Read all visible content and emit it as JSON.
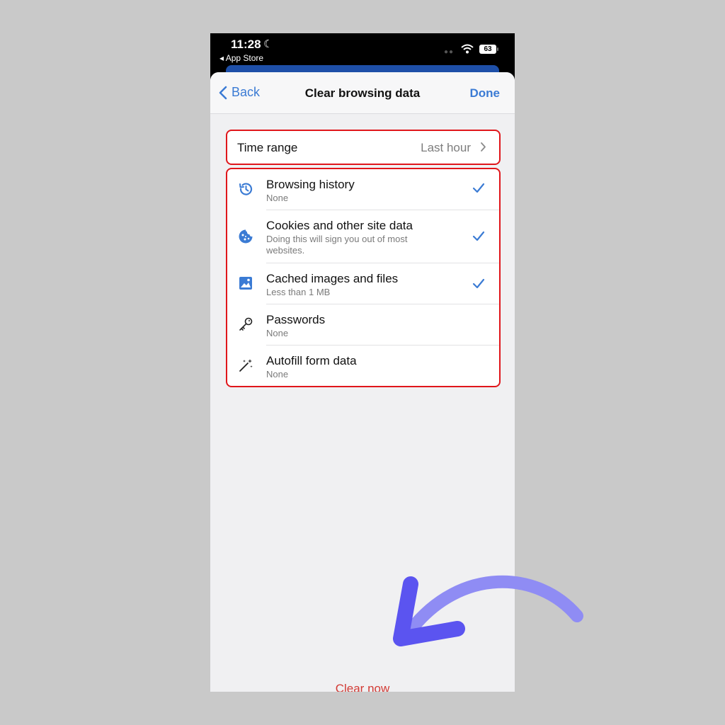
{
  "status_bar": {
    "time": "11:28",
    "back_app": "App Store",
    "battery": "63"
  },
  "nav": {
    "back_label": "Back",
    "title": "Clear browsing data",
    "done_label": "Done"
  },
  "time_range": {
    "label": "Time range",
    "value": "Last hour"
  },
  "items": [
    {
      "title": "Browsing history",
      "subtitle": "None",
      "checked": true,
      "icon": "history-icon"
    },
    {
      "title": "Cookies and other site data",
      "subtitle": "Doing this will sign you out of most websites.",
      "checked": true,
      "icon": "cookie-icon"
    },
    {
      "title": "Cached images and files",
      "subtitle": "Less than 1 MB",
      "checked": true,
      "icon": "image-icon"
    },
    {
      "title": "Passwords",
      "subtitle": "None",
      "checked": false,
      "icon": "key-icon"
    },
    {
      "title": "Autofill form data",
      "subtitle": "None",
      "checked": false,
      "icon": "magic-wand-icon"
    }
  ],
  "footer": {
    "clear_label": "Clear now"
  },
  "colors": {
    "accent": "#3b7bd4",
    "highlight": "#e0161b",
    "destructive": "#d23a34",
    "arrow": "#5b54f0"
  }
}
